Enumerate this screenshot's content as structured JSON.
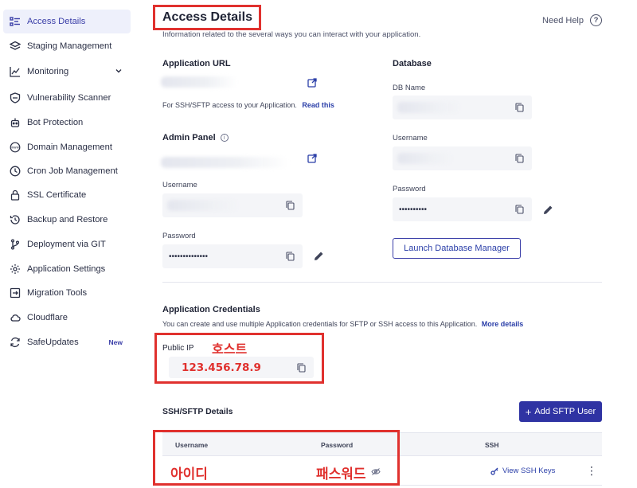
{
  "sidebar": {
    "items": [
      {
        "label": "Access Details",
        "icon": "access-details-icon"
      },
      {
        "label": "Staging Management",
        "icon": "layers-icon"
      },
      {
        "label": "Monitoring",
        "icon": "chart-line-icon"
      },
      {
        "label": "Vulnerability Scanner",
        "icon": "shield-scan-icon"
      },
      {
        "label": "Bot Protection",
        "icon": "robot-icon"
      },
      {
        "label": "Domain Management",
        "icon": "www-icon"
      },
      {
        "label": "Cron Job Management",
        "icon": "clock-icon"
      },
      {
        "label": "SSL Certificate",
        "icon": "lock-icon"
      },
      {
        "label": "Backup and Restore",
        "icon": "backup-icon"
      },
      {
        "label": "Deployment via GIT",
        "icon": "git-icon"
      },
      {
        "label": "Application Settings",
        "icon": "gear-icon"
      },
      {
        "label": "Migration Tools",
        "icon": "migration-icon"
      },
      {
        "label": "Cloudflare",
        "icon": "cloud-icon"
      },
      {
        "label": "SafeUpdates",
        "icon": "refresh-icon",
        "badge": "New"
      }
    ]
  },
  "header": {
    "title": "Access Details",
    "subtitle": "Information related to the several ways you can interact with your application.",
    "help": "Need Help",
    "help_icon": "?"
  },
  "app_url": {
    "title": "Application URL",
    "ssh_note": "For SSH/SFTP access to your Application.",
    "read_this": "Read this"
  },
  "admin_panel": {
    "title": "Admin Panel",
    "info_icon": "i",
    "username_label": "Username",
    "password_label": "Password",
    "password_value": "••••••••••••••"
  },
  "database": {
    "title": "Database",
    "db_name_label": "DB Name",
    "username_label": "Username",
    "password_label": "Password",
    "password_value": "••••••••••",
    "launch_button": "Launch Database Manager"
  },
  "credentials": {
    "title": "Application Credentials",
    "description": "You can create and use multiple Application credentials for SFTP or SSH access to this Application.",
    "more_details": "More details",
    "public_ip_label": "Public IP",
    "public_ip_annotation": "호스트",
    "public_ip_value": "123.456.78.9"
  },
  "ssh_sftp": {
    "title": "SSH/SFTP Details",
    "add_button": "Add SFTP User",
    "add_button_icon": "+",
    "columns": [
      "Username",
      "Password",
      "SSH"
    ],
    "row": {
      "username_annotation": "아이디",
      "password_annotation": "패스워드",
      "ssh_link": "View SSH Keys",
      "menu": "⋮"
    }
  },
  "colors": {
    "accent": "#2f33a3",
    "highlight": "#e0312e"
  }
}
